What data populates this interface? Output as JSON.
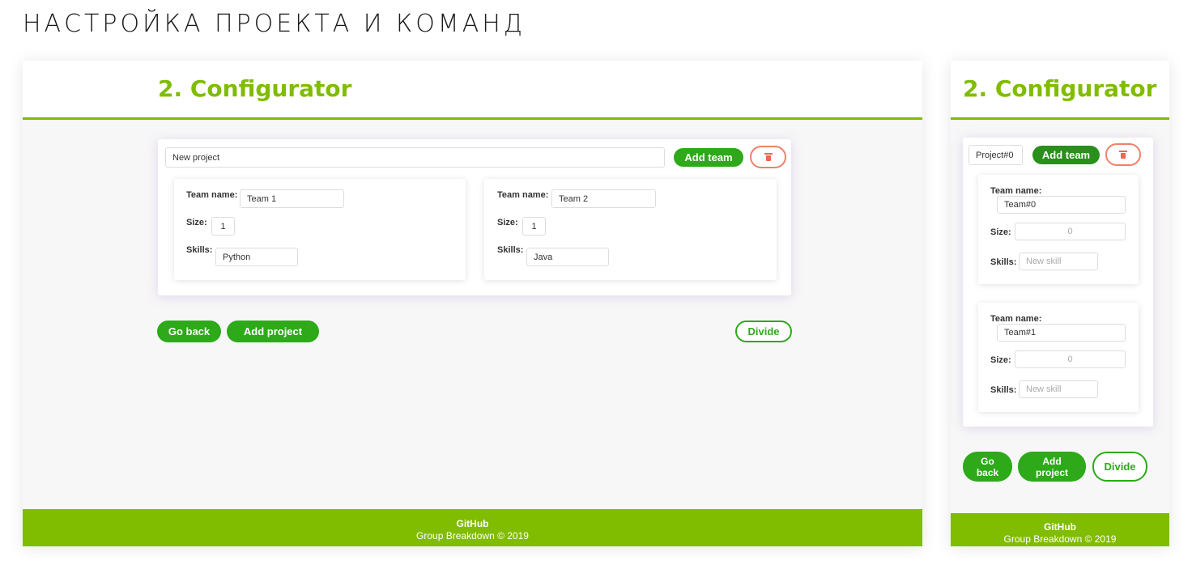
{
  "heading": "НАСТРОЙКА ПРОЕКТА И КОМАНД",
  "app_title": "2. Configurator",
  "desktop": {
    "project_name": "New project",
    "add_team_label": "Add team",
    "teams": [
      {
        "name_label": "Team name:",
        "name_value": "Team 1",
        "size_label": "Size:",
        "size_value": "1",
        "skills_label": "Skills:",
        "skills_value": "Python"
      },
      {
        "name_label": "Team name:",
        "name_value": "Team 2",
        "size_label": "Size:",
        "size_value": "1",
        "skills_label": "Skills:",
        "skills_value": "Java"
      }
    ],
    "go_back_label": "Go back",
    "add_project_label": "Add project",
    "divide_label": "Divide"
  },
  "mobile": {
    "project_name": "Project#0",
    "add_team_label": "Add team",
    "teams": [
      {
        "name_label": "Team name:",
        "name_value": "Team#0",
        "size_label": "Size:",
        "size_placeholder": "0",
        "skills_label": "Skills:",
        "skills_placeholder": "New skill"
      },
      {
        "name_label": "Team name:",
        "name_value": "Team#1",
        "size_label": "Size:",
        "size_placeholder": "0",
        "skills_label": "Skills:",
        "skills_placeholder": "New skill"
      }
    ],
    "go_back_label": "Go back",
    "add_project_label": "Add project",
    "divide_label": "Divide"
  },
  "footer": {
    "link": "GitHub",
    "copyright": "Group Breakdown © 2019"
  },
  "colors": {
    "brand": "#80bc00",
    "button_green": "#2da91a",
    "delete_red": "#f0806a"
  },
  "icons": {
    "delete": "trash-icon"
  }
}
